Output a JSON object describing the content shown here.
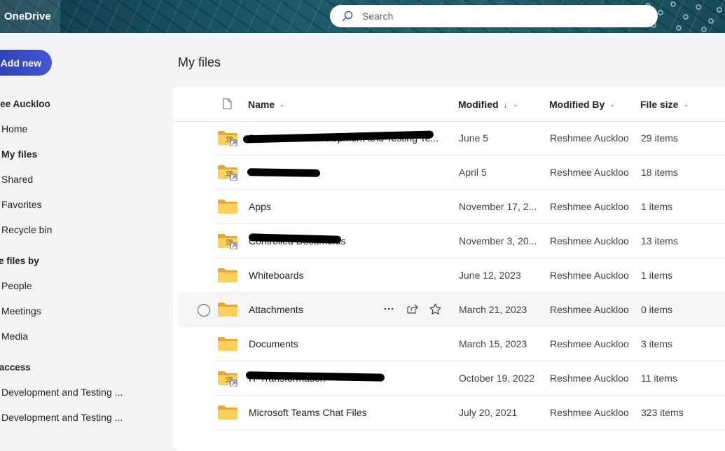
{
  "app": {
    "name": "OneDrive"
  },
  "search": {
    "placeholder": "Search"
  },
  "sidebar": {
    "add_new": "Add new",
    "user": "hmee Auckloo",
    "items": [
      {
        "label": "Home"
      },
      {
        "label": "My files"
      },
      {
        "label": "Shared"
      },
      {
        "label": "Favorites"
      },
      {
        "label": "Recycle bin"
      }
    ],
    "browse_title": "wse files by",
    "browse_items": [
      {
        "label": "People"
      },
      {
        "label": "Meetings"
      },
      {
        "label": "Media"
      }
    ],
    "quick_title": "ck access",
    "quick_items": [
      {
        "label": "Development and Testing ..."
      },
      {
        "label": "Development and Testing ..."
      }
    ]
  },
  "main": {
    "title": "My files",
    "columns": {
      "name": "Name",
      "modified": "Modified",
      "modified_by": "Modified By",
      "file_size": "File size"
    },
    "rows": [
      {
        "name": "Documents - Development and Testing Te...",
        "modified": "June 5",
        "by": "Reshmee Auckloo",
        "size": "29 items",
        "shared": true
      },
      {
        "name": "",
        "modified": "April 5",
        "by": "Reshmee Auckloo",
        "size": "18 items",
        "shared": true
      },
      {
        "name": "Apps",
        "modified": "November 17, 2...",
        "by": "Reshmee Auckloo",
        "size": "1 items",
        "shared": false
      },
      {
        "name": "Controlled Documents",
        "modified": "November 3, 20...",
        "by": "Reshmee Auckloo",
        "size": "13 items",
        "shared": true
      },
      {
        "name": "Whiteboards",
        "modified": "June 12, 2023",
        "by": "Reshmee Auckloo",
        "size": "1 items",
        "shared": false
      },
      {
        "name": "Attachments",
        "modified": "March 21, 2023",
        "by": "Reshmee Auckloo",
        "size": "0 items",
        "shared": false
      },
      {
        "name": "Documents",
        "modified": "March 15, 2023",
        "by": "Reshmee Auckloo",
        "size": "3 items",
        "shared": false
      },
      {
        "name": "IT Transformation",
        "modified": "October 19, 2022",
        "by": "Reshmee Auckloo",
        "size": "11 items",
        "shared": true
      },
      {
        "name": "Microsoft Teams Chat Files",
        "modified": "July 20, 2021",
        "by": "Reshmee Auckloo",
        "size": "323 items",
        "shared": false
      }
    ]
  },
  "colors": {
    "accent": "#3b50c4",
    "folder": "#f6c342",
    "header": "#1b4e5e"
  }
}
